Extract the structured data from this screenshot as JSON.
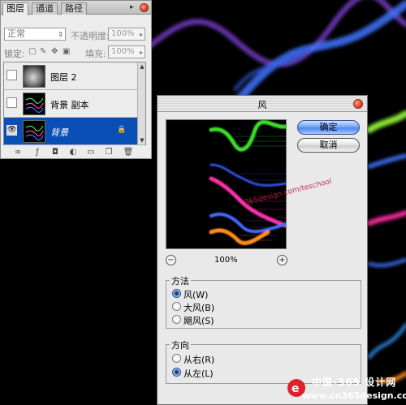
{
  "layers_panel": {
    "tabs": [
      "图层",
      "通道",
      "路径"
    ],
    "blend_mode": "正常",
    "opacity_label": "不透明度:",
    "opacity_value": "100%",
    "lock_label": "锁定:",
    "fill_label": "填充:",
    "fill_value": "100%",
    "layers": [
      {
        "name": "图层 2",
        "visible": false,
        "selected": false
      },
      {
        "name": "背景 副本",
        "visible": false,
        "selected": false
      },
      {
        "name": "背景",
        "visible": true,
        "selected": true,
        "locked": true
      }
    ],
    "bottom_icons": [
      "link-icon",
      "layer-style-icon",
      "mask-icon",
      "adjustment-icon",
      "folder-icon",
      "new-layer-icon",
      "trash-icon"
    ]
  },
  "wind_dialog": {
    "title": "风",
    "ok_label": "确定",
    "cancel_label": "取消",
    "zoom": "100%",
    "zoom_out_label": "−",
    "zoom_in_label": "+",
    "method": {
      "label": "方法",
      "options": [
        "风(W)",
        "大风(B)",
        "飓风(S)"
      ],
      "selected": 0
    },
    "direction": {
      "label": "方向",
      "options": [
        "从右(R)",
        "从左(L)"
      ],
      "selected": 1
    }
  },
  "watermark": {
    "line1": "中国-365 设计网",
    "line2": "www.cn365design.com",
    "diagonal_url": "365design.com/teschool"
  },
  "colors": {
    "selected_row": "#0a4fb5",
    "ok_button": "#4d85ee",
    "close_button": "#d53418"
  }
}
